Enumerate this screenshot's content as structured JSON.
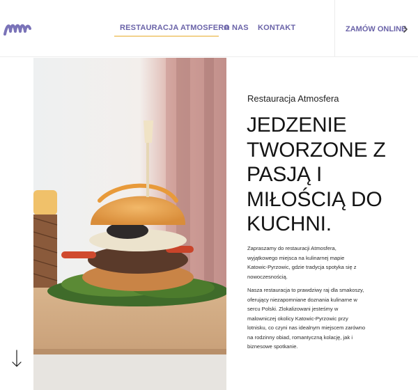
{
  "header": {
    "logo_icon": "wave-logo-icon",
    "nav": [
      {
        "label": "RESTAURACJA ATMOSFERA",
        "active": true
      },
      {
        "label": "O NAS",
        "active": false
      },
      {
        "label": "KONTAKT",
        "active": false
      }
    ],
    "order_label": "ZAMÓW ONLINE",
    "order_icon": "chevron-right-icon"
  },
  "hero": {
    "photo": "burger-photo",
    "subtitle": "Restauracja Atmosfera",
    "headline": "JEDZENIE TWORZONE Z PASJĄ I MIŁOŚCIĄ DO KUCHNI.",
    "paragraph_1": "Zapraszamy do restauracji Atmosfera, wyjątkowego miejsca na kulinarnej mapie Katowic-Pyrzowic, gdzie tradycja spotyka się z nowoczesnością.",
    "paragraph_2": "Nasza restauracja to prawdziwy raj dla smakoszy, oferujący niezapomniane doznania kulinarne w sercu Polski. Zlokalizowani jesteśmy w malowniczej okolicy Katowic-Pyrzowic przy lotnisku, co czyni nas idealnym miejscem zarówno na rodzinny obiad, romantyczną kolację, jak i biznesowe spotkanie.",
    "scroll_icon": "arrow-down-icon"
  },
  "colors": {
    "accent": "#6a63a8",
    "underline": "#f2d28c",
    "text": "#141414"
  }
}
